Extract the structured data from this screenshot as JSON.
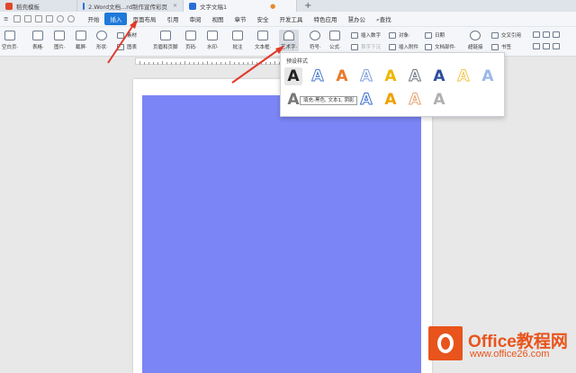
{
  "tabs": [
    {
      "label": "稻壳模板",
      "color": "#e0462b"
    },
    {
      "label": "2.Word文档...rd制作宣传彩页",
      "color": "#2b6fd6"
    },
    {
      "label": "文字文稿1",
      "color": "#2b6fd6"
    }
  ],
  "menu": [
    "开始",
    "插入",
    "页面布局",
    "引用",
    "审阅",
    "视图",
    "章节",
    "安全",
    "开发工具",
    "特色应用",
    "慧办公",
    "查找"
  ],
  "active_menu": "插入",
  "ribbon": {
    "large": [
      {
        "label": "空白页·",
        "name": "blank-page"
      },
      {
        "label": "表格·",
        "name": "table"
      },
      {
        "label": "图片·",
        "name": "picture"
      },
      {
        "label": "截屏·",
        "name": "screenshot"
      },
      {
        "label": "形状·",
        "name": "shape"
      },
      {
        "label": "页眉和页脚",
        "name": "header-footer"
      },
      {
        "label": "页码·",
        "name": "page-number"
      },
      {
        "label": "水印·",
        "name": "watermark"
      },
      {
        "label": "批注",
        "name": "comment"
      },
      {
        "label": "文本框·",
        "name": "textbox"
      },
      {
        "label": "艺术字·",
        "name": "wordart"
      },
      {
        "label": "符号·",
        "name": "symbol"
      },
      {
        "label": "公式·",
        "name": "formula"
      },
      {
        "label": "超链接",
        "name": "hyperlink"
      }
    ],
    "small": [
      {
        "label": "素材",
        "name": "material"
      },
      {
        "label": "图表",
        "name": "chart"
      },
      {
        "label": "插入数字",
        "name": "insert-number"
      },
      {
        "label": "对象·",
        "name": "object"
      },
      {
        "label": "日期",
        "name": "date"
      },
      {
        "label": "首字下沉",
        "name": "drop-cap"
      },
      {
        "label": "插入附件",
        "name": "insert-attachment"
      },
      {
        "label": "文档部件·",
        "name": "doc-parts"
      },
      {
        "label": "交叉引用",
        "name": "cross-reference"
      },
      {
        "label": "书签",
        "name": "bookmark"
      }
    ]
  },
  "popup": {
    "title": "预设样式",
    "glyph": "A",
    "tooltip": "填充-黑色, 文本1, 阴影",
    "row1_colors": [
      "#222222",
      "#4a7bd0",
      "#e87a2b",
      "#7b9fe0",
      "#f0b400",
      "#6b7280",
      "#2d4f9e",
      "#f3c64a",
      "#9ab8e8"
    ],
    "row2_colors": [
      "#777777",
      "#3a6fd0",
      "#f0a000",
      "#e8a070",
      "#b0b0b0"
    ]
  },
  "logo": {
    "brand": "Office教程网",
    "url": "www.office26.com"
  }
}
